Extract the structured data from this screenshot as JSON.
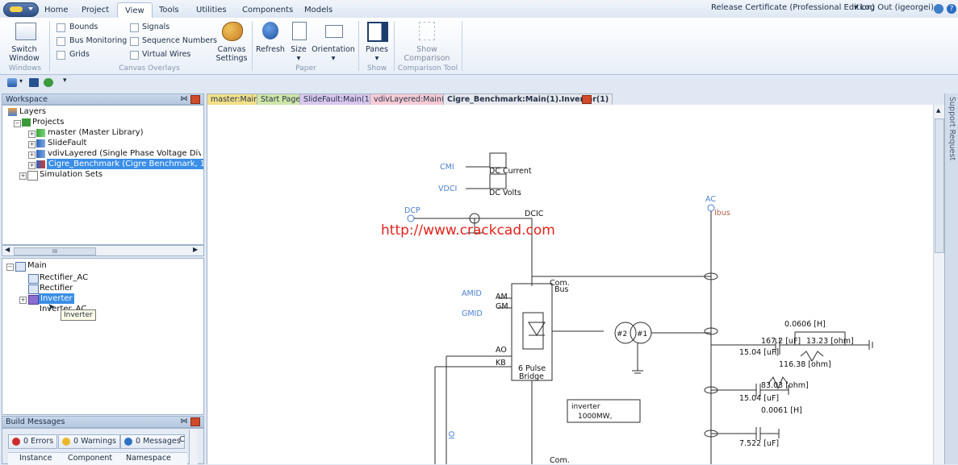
{
  "tabs": [
    "Home",
    "Project",
    "View",
    "Tools",
    "Utilities",
    "Components",
    "Models"
  ],
  "active_tab": "View",
  "topright": {
    "release": "Release Certificate (Professional Edition)",
    "logout": "Log Out (igeorgei)"
  },
  "ribbon": {
    "switch_window": [
      "Switch",
      "Window"
    ],
    "windows_group": "Windows",
    "checkboxes": {
      "bounds": "Bounds",
      "bus_monitoring": "Bus Monitoring",
      "grids": "Grids",
      "signals": "Signals",
      "sequence_numbers": "Sequence Numbers",
      "virtual_wires": "Virtual Wires"
    },
    "canvas_overlays_group": "Canvas Overlays",
    "canvas_settings": [
      "Canvas",
      "Settings"
    ],
    "refresh": "Refresh",
    "size": "Size",
    "orientation": "Orientation",
    "paper_group": "Paper",
    "panes": "Panes",
    "show_group": "Show",
    "show_comparison": [
      "Show",
      "Comparison"
    ],
    "comparison_group": "Comparison Tool"
  },
  "workspace": {
    "title": "Workspace",
    "layers": "Layers",
    "projects": "Projects",
    "items": [
      "master (Master Library)",
      "SlideFault",
      "vdivLayered (Single Phase Voltage Divide",
      "Cigre_Benchmark (Cigre Benchmark, 12 p"
    ],
    "simulation_sets": "Simulation Sets",
    "scroll_mark": "III"
  },
  "hierarchy": {
    "root": "Main",
    "items": [
      "Rectifier_AC",
      "Rectifier",
      "Inverter",
      "Inverter_AC"
    ],
    "tooltip": "Inverter"
  },
  "build_messages": {
    "title": "Build Messages",
    "errors": "0 Errors",
    "warnings": "0 Warnings",
    "messages": "0 Messages",
    "more": "C",
    "columns": [
      "Instance",
      "Component",
      "Namespace"
    ]
  },
  "doc_tabs": [
    {
      "label": "master:Main",
      "color": "#f3e08a"
    },
    {
      "label": "Start Page",
      "color": "#cfe6a8"
    },
    {
      "label": "SlideFault:Main(1)",
      "color": "#d9c7ec"
    },
    {
      "label": "vdivLayered:Main(1)",
      "color": "#f7cbd4"
    },
    {
      "label": "Cigre_Benchmark:Main(1).Inverter(1)",
      "color": "#e7e9ee"
    }
  ],
  "right_panel": "Support Request",
  "canvas": {
    "watermark": "http://www.crackcad.com",
    "cmi": "CMI",
    "vdci": "VDCI",
    "dc_current": "DC Current",
    "dc_volts": "DC Volts",
    "dcp": "DCP",
    "dcic": "DCIC",
    "ac": "AC",
    "ibus": "Ibus",
    "amid": "AMID",
    "gmid": "GMID",
    "am": "AM",
    "gm": "GM",
    "ao": "AO",
    "kb": "KB",
    "pulse": "6 Pulse",
    "bridge": "Bridge",
    "com": "Com.",
    "bus": "Bus",
    "t2": "#2",
    "t1": "#1",
    "note_line1": "inverter",
    "note_line2": "1000MW,",
    "l1": "0.0606 [H]",
    "c1": "167.2 [uF]",
    "r1": "13.23 [ohm]",
    "c2": "15.04 [uF]",
    "r2": "116.38 [ohm]",
    "r3": "83.03 [ohm]",
    "c3": "15.04 [uF]",
    "l3": "0.0061 [H]",
    "c4": "7.522 [uF]",
    "io": "IO",
    "com2": "Com."
  },
  "colors": {
    "accent_blue": "#3a8ee6",
    "signal_blue": "#4a7fd1",
    "watermark_red": "#e0241b",
    "ibus_brown": "#b0604a"
  }
}
